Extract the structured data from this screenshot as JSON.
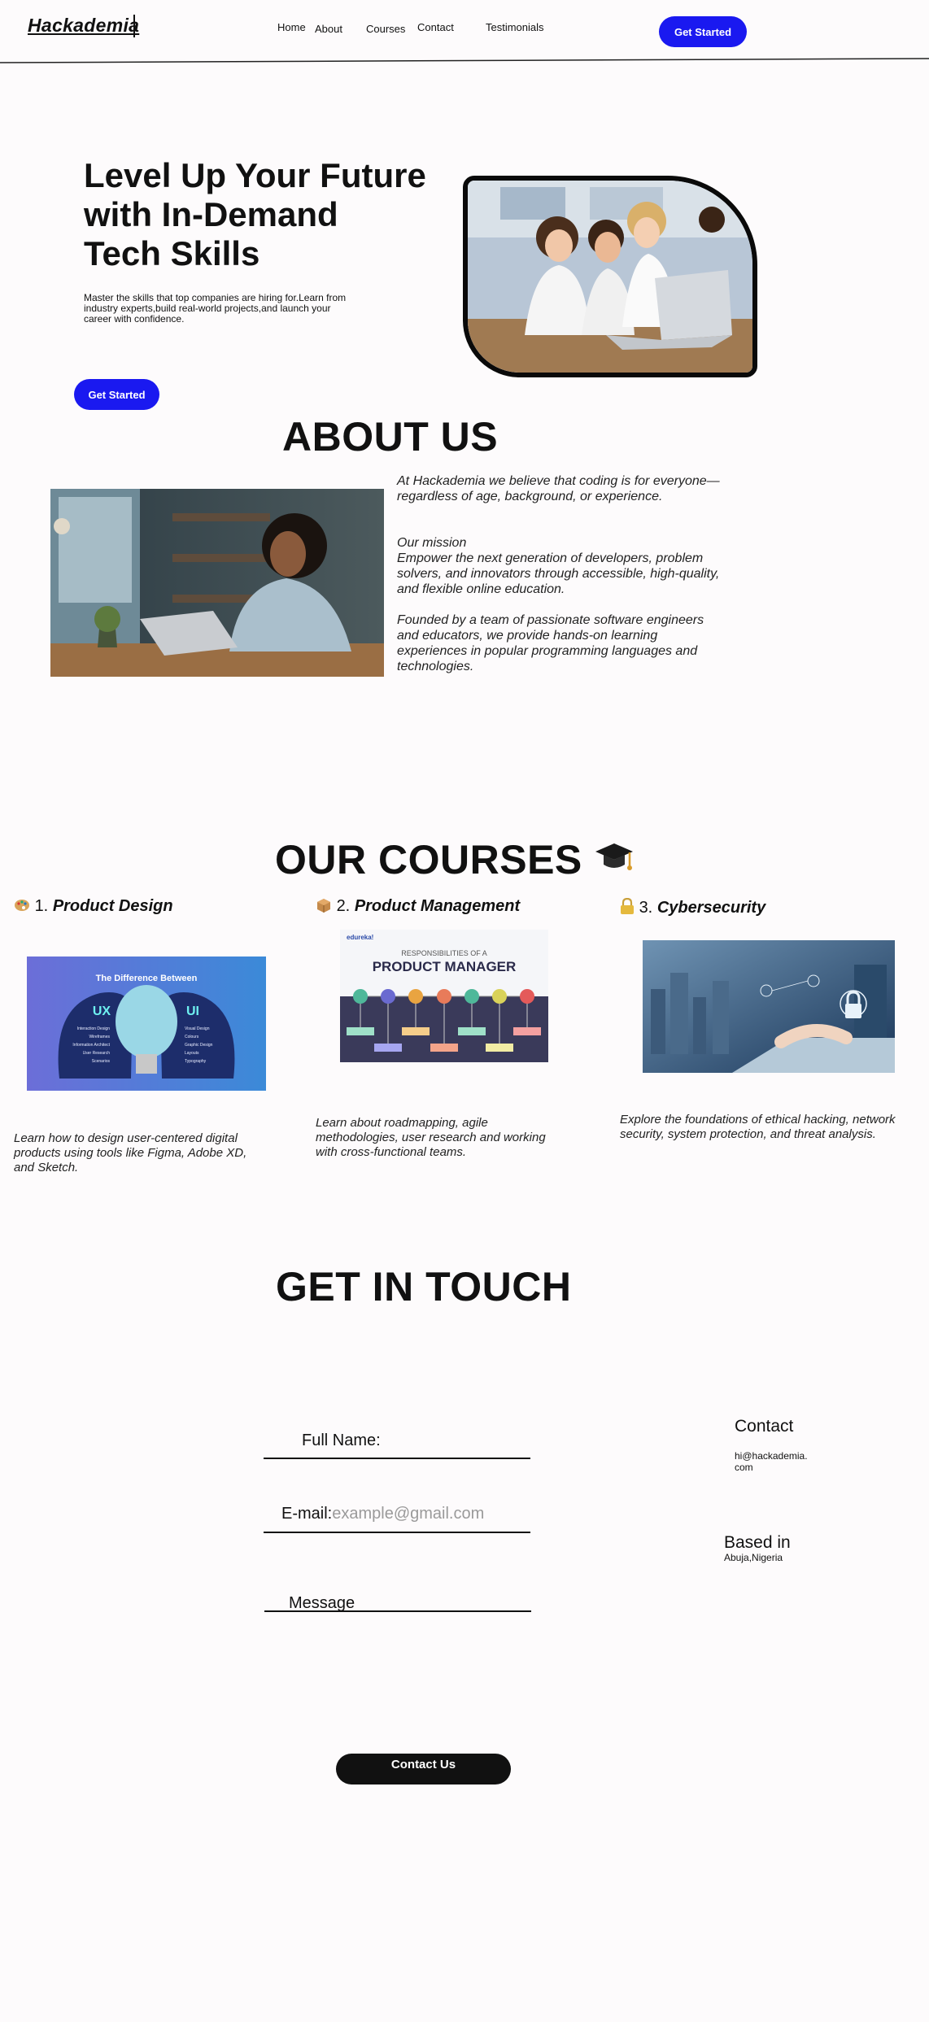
{
  "brand": "Hackademia",
  "nav": {
    "home": "Home",
    "about": "About",
    "courses": "Courses",
    "contact": "Contact",
    "testimonials": "Testimonials",
    "cta": "Get Started"
  },
  "hero": {
    "title_line1": "Level Up Your Future",
    "title_line2": "with In-Demand",
    "title_line3": "Tech Skills",
    "subtitle": "Master the skills that top companies are hiring for.Learn from industry experts,build real-world projects,and launch your career with confidence.",
    "cta": "Get Started"
  },
  "about": {
    "heading": "ABOUT US",
    "para1": "At Hackademia  we believe that coding is for everyone—regardless of age, background, or experience.",
    "mission_title": "Our mission",
    "mission_text": " Empower the next generation of developers, problem solvers, and innovators through accessible, high-quality, and flexible online education.",
    "para3": "Founded by a team of passionate software engineers and educators, we provide hands-on learning experiences in popular programming languages and technologies."
  },
  "courses": {
    "heading": "OUR COURSES",
    "items": [
      {
        "num": "1.",
        "title": "Product Design",
        "desc": "Learn how to design user-centered digital products using tools like Figma, Adobe XD, and Sketch.",
        "img_title": "The Difference Between",
        "ux": "UX",
        "ui": "UI",
        "ux_list": [
          "Interaction Design",
          "Wireframes",
          "Information Architect",
          "User Research",
          "Scenarios"
        ],
        "ui_list": [
          "Visual Design",
          "Colours",
          "Graphic Design",
          "Layouts",
          "Typography"
        ]
      },
      {
        "num": "2.",
        "title": "Product Management",
        "desc": " Learn about roadmapping, agile methodologies, user research and working with cross-functional teams.",
        "img_brand": "edureka!",
        "img_sub": "RESPONSIBILITIES OF A",
        "img_title": "PRODUCT MANAGER"
      },
      {
        "num": "3.",
        "title": "Cybersecurity",
        "desc": "Explore the foundations of ethical hacking, network security, system protection, and threat analysis."
      }
    ]
  },
  "contact": {
    "heading": "GET IN TOUCH",
    "full_name_label": "Full Name:",
    "email_label": "E-mail:",
    "email_placeholder": "example@gmail.com",
    "message_label": "Message",
    "submit": "Contact Us",
    "side_contact_title": "Contact",
    "side_email_line1": "hi@hackademia.",
    "side_email_line2": "com",
    "based_title": "Based in",
    "based_value": "Abuja,Nigeria"
  },
  "colors": {
    "accent": "#1a19f0",
    "background": "#fdfbfc",
    "text": "#111111"
  },
  "icons": {
    "course1": "palette-icon",
    "course2": "package-icon",
    "course3": "lock-icon",
    "courses_heading": "graduation-cap-icon"
  }
}
